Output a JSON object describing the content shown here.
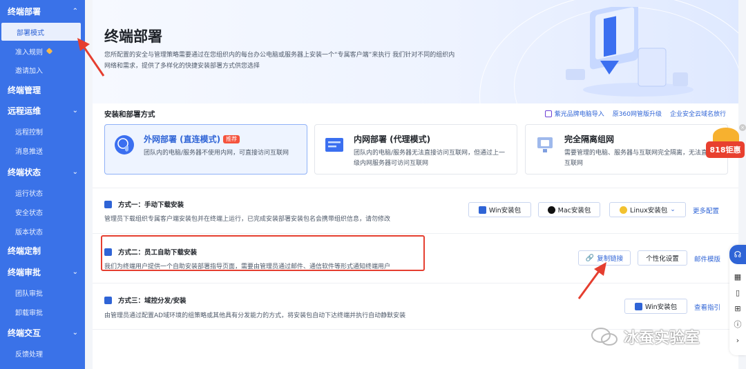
{
  "sidebar": {
    "groups": [
      {
        "label": "终端部署",
        "items": [
          {
            "label": "部署模式",
            "active": true
          },
          {
            "label": "准入规则",
            "badge": true
          },
          {
            "label": "邀请加入"
          }
        ]
      },
      {
        "label": "终端管理",
        "items": []
      },
      {
        "label": "远程运维",
        "items": [
          {
            "label": "远程控制"
          },
          {
            "label": "消息推送"
          }
        ]
      },
      {
        "label": "终端状态",
        "items": [
          {
            "label": "运行状态"
          },
          {
            "label": "安全状态"
          },
          {
            "label": "版本状态"
          }
        ]
      },
      {
        "label": "终端定制",
        "items": []
      },
      {
        "label": "终端审批",
        "items": [
          {
            "label": "团队审批"
          },
          {
            "label": "卸载审批"
          }
        ]
      },
      {
        "label": "终端交互",
        "items": [
          {
            "label": "反馈处理"
          }
        ]
      }
    ]
  },
  "hero": {
    "title": "终端部署",
    "description": "您所配置的安全与管理策略需要通过在您组织内的每台办公电脑或服务器上安装一个“专属客户端”来执行 我们针对不同的组织内网络和需求，提供了多样化的快捷安装部署方式供您选择"
  },
  "install_section": {
    "title": "安装和部署方式",
    "links": [
      "紫光品牌电脑导入",
      "原360网管版升级",
      "企业安全云域名放行"
    ]
  },
  "modes": [
    {
      "title": "外网部署 (直连模式)",
      "tag": "推荐",
      "desc": "团队内的电脑/服务器不使用内网，可直接访问互联网",
      "selected": true
    },
    {
      "title": "内网部署 (代理模式)",
      "tag": "",
      "desc": "团队内的电脑/服务器无法直接访问互联网，但通过上一级内网服务器可访问互联网",
      "selected": false
    },
    {
      "title": "完全隔离组网",
      "tag": "",
      "desc": "需要管理的电脑、服务器与互联网完全隔离，无法直接互联网",
      "selected": false
    }
  ],
  "methods": {
    "m1": {
      "title": "方式一：手动下载安装",
      "desc": "管理员下载组织专属客户端安装包并在终端上运行，已完成安装部署安装包名会携带组织信息，请勿修改",
      "buttons": [
        "Win安装包",
        "Mac安装包",
        "Linux安装包"
      ],
      "link": "更多配置"
    },
    "m2": {
      "title": "方式二：员工自助下载安装",
      "desc": "我们为终端用户提供一个自助安装部署指导页面，需要由管理员通过邮件、通信软件等形式通知终端用户",
      "buttons": [
        "复制链接",
        "个性化设置"
      ],
      "link": "邮件模版"
    },
    "m3": {
      "title": "方式三：域控分发/安装",
      "desc": "由管理员通过配置AD域环境的组策略或其他具有分发能力的方式，将安装包自动下达终端并执行自动静默安装",
      "buttons": [
        "Win安装包"
      ],
      "link": "查看指引"
    }
  },
  "promo": {
    "label": "818钜惠"
  },
  "watermark": {
    "text": "冰蚕实验室"
  },
  "colors": {
    "sidebar": "#3a72e8",
    "accent": "#2f64d6",
    "highlight": "#e53e2f",
    "tag": "#f5533d"
  }
}
